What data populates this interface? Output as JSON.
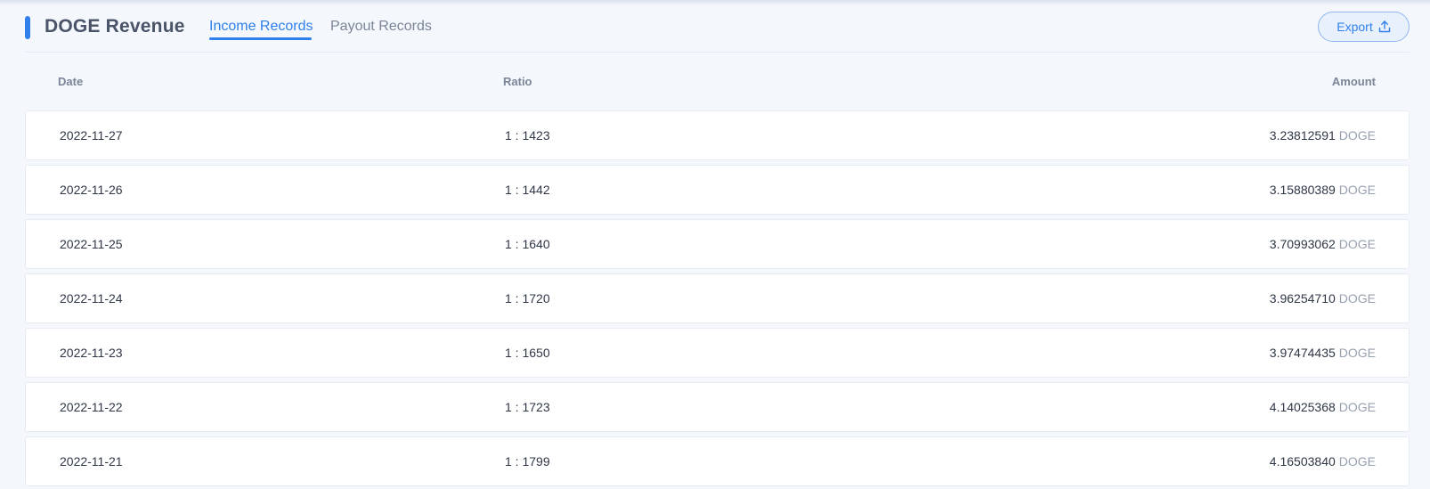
{
  "header": {
    "title": "DOGE Revenue",
    "tabs": [
      {
        "label": "Income Records",
        "active": true
      },
      {
        "label": "Payout Records",
        "active": false
      }
    ],
    "export_label": "Export",
    "export_icon": "upload-icon"
  },
  "table": {
    "columns": [
      "Date",
      "Ratio",
      "Amount"
    ],
    "rows": [
      {
        "date": "2022-11-27",
        "ratio": "1 : 1423",
        "amount": "3.23812591",
        "unit": "DOGE"
      },
      {
        "date": "2022-11-26",
        "ratio": "1 : 1442",
        "amount": "3.15880389",
        "unit": "DOGE"
      },
      {
        "date": "2022-11-25",
        "ratio": "1 : 1640",
        "amount": "3.70993062",
        "unit": "DOGE"
      },
      {
        "date": "2022-11-24",
        "ratio": "1 : 1720",
        "amount": "3.96254710",
        "unit": "DOGE"
      },
      {
        "date": "2022-11-23",
        "ratio": "1 : 1650",
        "amount": "3.97474435",
        "unit": "DOGE"
      },
      {
        "date": "2022-11-22",
        "ratio": "1 : 1723",
        "amount": "4.14025368",
        "unit": "DOGE"
      },
      {
        "date": "2022-11-21",
        "ratio": "1 : 1799",
        "amount": "4.16503840",
        "unit": "DOGE"
      }
    ]
  },
  "colors": {
    "accent": "#2f80ed",
    "background": "#f4f7fc",
    "row_background": "#ffffff",
    "muted_text": "#7b8597",
    "unit_text": "#97a0b0"
  }
}
